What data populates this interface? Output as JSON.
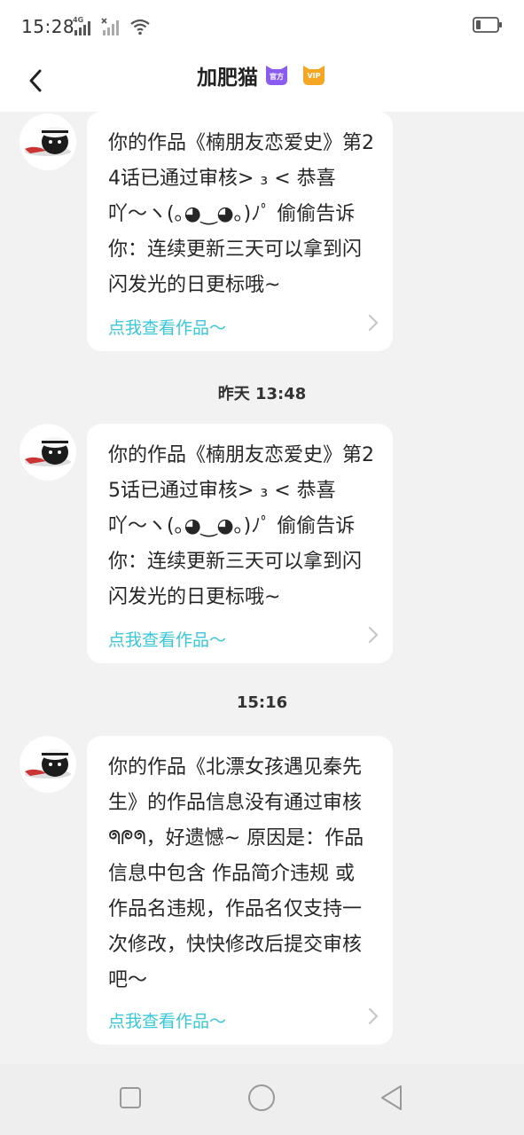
{
  "status_bar": {
    "time": "15:28",
    "network_label": "4G",
    "icons": [
      "signal-4g-icon",
      "signal-no-sim-icon",
      "wifi-icon",
      "battery-icon"
    ]
  },
  "header": {
    "title": "加肥猫",
    "official_badge": "官方",
    "vip_badge": "VIP",
    "back_icon": "chevron-left-icon"
  },
  "messages": [
    {
      "text": "你的作品《楠朋友恋爱史》第24话已通过审核> ₃ < 恭喜吖〜ヽ(｡◕‿◕｡)ﾉﾟ 偷偷告诉你：连续更新三天可以拿到闪闪发光的日更标哦~",
      "link": "点我查看作品〜"
    },
    {
      "text": "你的作品《楠朋友恋爱史》第25话已通过审核> ₃ < 恭喜吖〜ヽ(｡◕‿◕｡)ﾉﾟ 偷偷告诉你：连续更新三天可以拿到闪闪发光的日更标哦~",
      "link": "点我查看作品〜"
    },
    {
      "text": "你的作品《北漂女孩遇见秦先生》的作品信息没有通过审核 ᖗᖘᖗ，好遗憾~ 原因是：作品信息中包含 作品简介违规 或 作品名违规，作品名仅支持一次修改，快快修改后提交审核吧〜",
      "link": "点我查看作品〜"
    }
  ],
  "time_dividers": [
    "昨天 13:48",
    "15:16"
  ],
  "colors": {
    "link": "#38c8d8",
    "official_badge": "#8a5cf0",
    "vip_badge": "#f5a623",
    "background": "#f2f2f2"
  },
  "navbar": {
    "icons": [
      "recent-apps-square-icon",
      "home-circle-icon",
      "back-triangle-icon"
    ]
  }
}
